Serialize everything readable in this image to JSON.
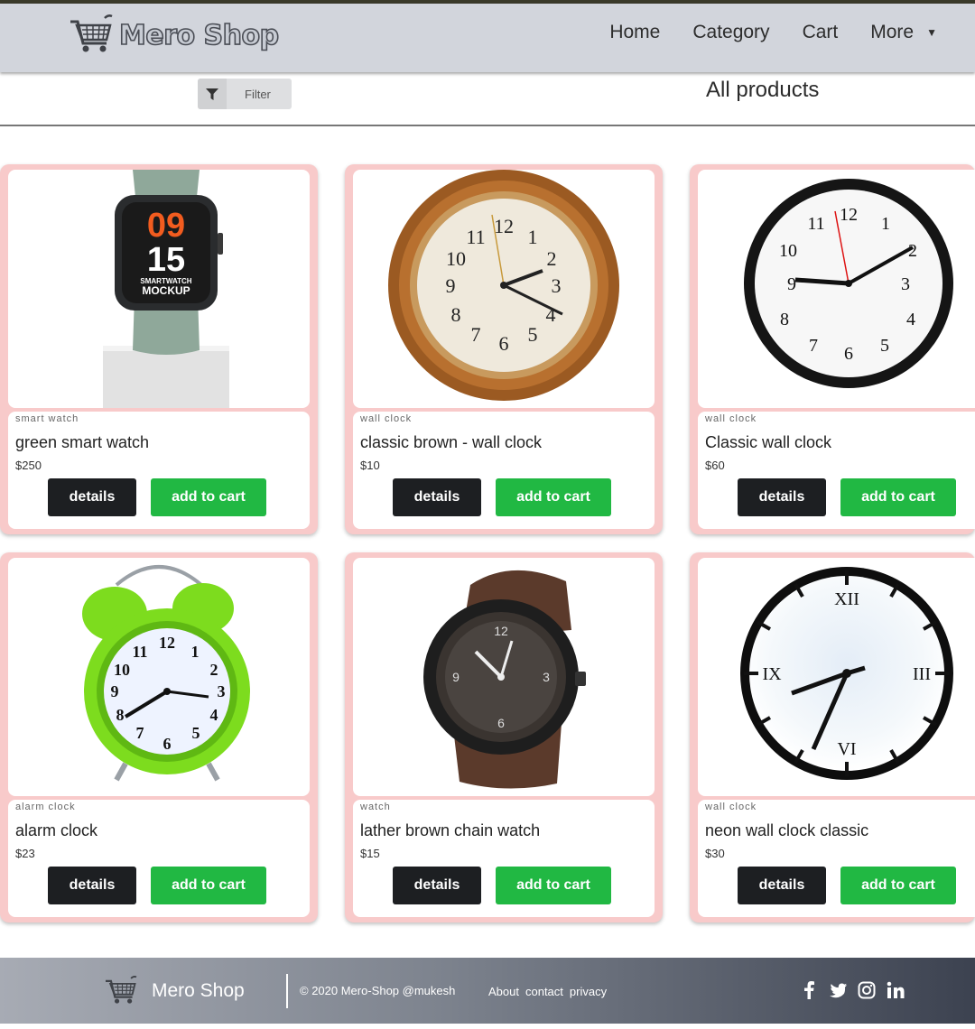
{
  "header": {
    "brand": "Mero Shop",
    "nav": [
      {
        "label": "Home"
      },
      {
        "label": "Category"
      },
      {
        "label": "Cart"
      },
      {
        "label": "More"
      }
    ]
  },
  "toolbar": {
    "filter_label": "Filter",
    "heading": "All products"
  },
  "products": [
    {
      "category": "smart watch",
      "name": "green smart watch",
      "price": "$250",
      "details_label": "details",
      "cart_label": "add to cart",
      "watch_digits_top": "09",
      "watch_digits_bottom": "15",
      "watch_caption_1": "SMARTWATCH",
      "watch_caption_2": "MOCKUP"
    },
    {
      "category": "wall clock",
      "name": "classic brown - wall clock",
      "price": "$10",
      "details_label": "details",
      "cart_label": "add to cart"
    },
    {
      "category": "wall clock",
      "name": "Classic wall clock",
      "price": "$60",
      "details_label": "details",
      "cart_label": "add to cart"
    },
    {
      "category": "alarm clock",
      "name": "alarm clock",
      "price": "$23",
      "details_label": "details",
      "cart_label": "add to cart"
    },
    {
      "category": "watch",
      "name": "lather brown chain watch",
      "price": "$15",
      "details_label": "details",
      "cart_label": "add to cart"
    },
    {
      "category": "wall clock",
      "name": "neon wall clock classic",
      "price": "$30",
      "details_label": "details",
      "cart_label": "add to cart",
      "roman": [
        "XII",
        "III",
        "VI",
        "IX"
      ]
    }
  ],
  "footer": {
    "brand": "Mero Shop",
    "copyright": "© 2020 Mero-Shop  @mukesh",
    "links": [
      "About",
      "contact",
      "privacy"
    ],
    "social_icons": [
      "facebook-icon",
      "twitter-icon",
      "instagram-icon",
      "linkedin-icon"
    ]
  },
  "colors": {
    "header_bg": "#d2d5dc",
    "card_bg": "#f8caca",
    "details_button": "#1d1f22",
    "cart_button": "#21b843"
  }
}
